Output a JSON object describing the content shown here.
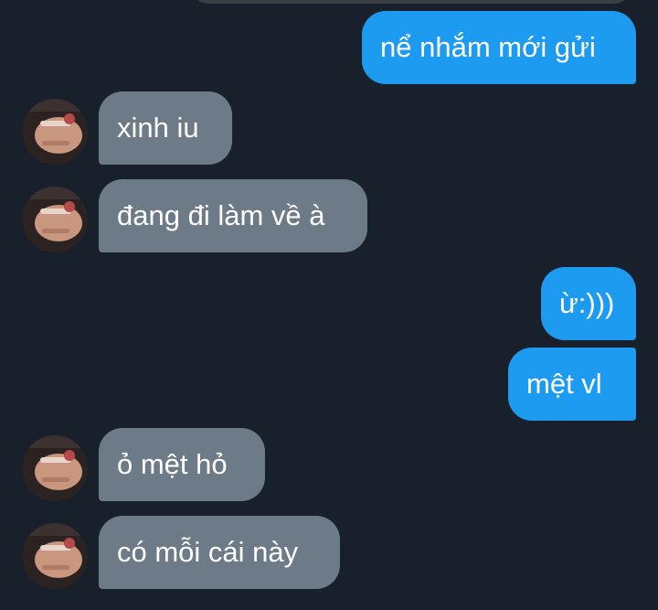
{
  "messages": [
    {
      "side": "out",
      "text": "nể nhắm mới gửi"
    },
    {
      "side": "in",
      "text": "xinh iu"
    },
    {
      "side": "in",
      "text": "đang đi làm về à"
    },
    {
      "side": "out",
      "text": "ừ:)))"
    },
    {
      "side": "out",
      "text": "mệt vl"
    },
    {
      "side": "in",
      "text": "ỏ mệt hỏ"
    },
    {
      "side": "in",
      "text": "có mỗi cái này"
    }
  ],
  "colors": {
    "background": "#17202b",
    "outgoing_bubble": "#1d9bf0",
    "incoming_bubble": "#6d7a88"
  },
  "icons": {
    "avatar": "contact-avatar-photo"
  }
}
